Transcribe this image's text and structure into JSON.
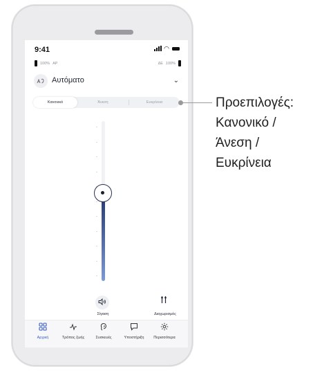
{
  "status_bar": {
    "time": "9:41"
  },
  "devices": {
    "left": {
      "battery": "100%",
      "side": "AP"
    },
    "right": {
      "side": "ΔΕ",
      "battery": "100%"
    }
  },
  "program": {
    "icon": "program-auto-icon",
    "label": "Αυτόματο",
    "chevron": "⌄"
  },
  "presets": {
    "items": [
      "Κανονικό",
      "Άνεση",
      "Ευκρίνεια"
    ],
    "selected": "Κανονικό"
  },
  "volume_slider": {
    "level": 0.55
  },
  "controls": {
    "mute": {
      "icon": "speaker-icon",
      "label": "Σίγαση"
    },
    "customize": {
      "icon": "sliders-icon",
      "label": "Διαχωρισμός"
    }
  },
  "nav": [
    {
      "label": "Αρχική",
      "icon": "home-grid-icon",
      "active": true
    },
    {
      "label": "Τρόπος ζωής",
      "icon": "activity-icon",
      "active": false
    },
    {
      "label": "Συσκευές",
      "icon": "hearing-aid-icon",
      "active": false
    },
    {
      "label": "Υποστήριξη",
      "icon": "chat-icon",
      "active": false
    },
    {
      "label": "Περισσότερα",
      "icon": "gear-icon",
      "active": false
    }
  ],
  "callout": {
    "text": "Προεπιλογές:\nΚανονικό /\nΆνεση /\nΕυκρίνεια"
  },
  "colors": {
    "accent": "#3a5cbb",
    "slider_top": "#24356e",
    "slider_bottom": "#7d9ad4"
  }
}
